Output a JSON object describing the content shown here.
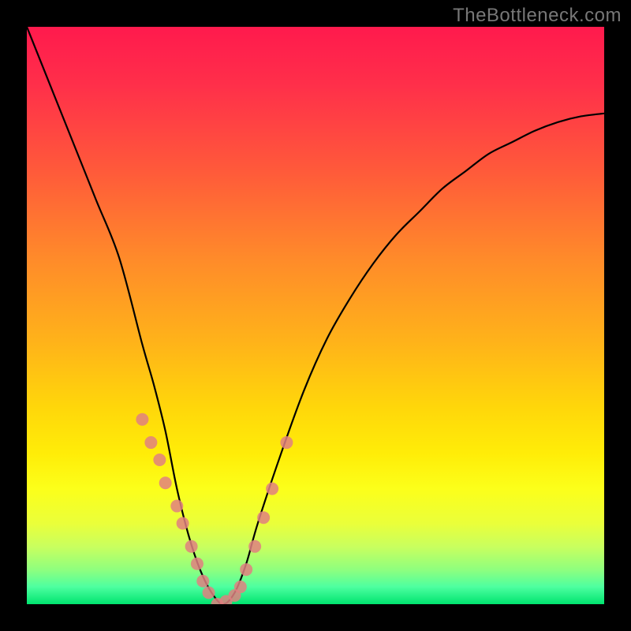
{
  "watermark": "TheBottleneck.com",
  "chart_data": {
    "type": "line",
    "title": "",
    "xlabel": "",
    "ylabel": "",
    "xlim": [
      0,
      100
    ],
    "ylim": [
      0,
      100
    ],
    "grid": false,
    "series": [
      {
        "name": "curve",
        "x": [
          0,
          4,
          8,
          12,
          16,
          20,
          22,
          24,
          26,
          28,
          30,
          32,
          34,
          36,
          38,
          40,
          44,
          48,
          52,
          56,
          60,
          64,
          68,
          72,
          76,
          80,
          84,
          88,
          92,
          96,
          100
        ],
        "values": [
          100,
          90,
          80,
          70,
          60,
          45,
          38,
          30,
          20,
          12,
          6,
          2,
          0,
          2,
          7,
          14,
          26,
          37,
          46,
          53,
          59,
          64,
          68,
          72,
          75,
          78,
          80,
          82,
          83.5,
          84.5,
          85
        ]
      }
    ],
    "markers": {
      "name": "scatter-points",
      "color": "#e08080",
      "x": [
        20,
        21.5,
        23,
        24,
        26,
        27,
        28.5,
        29.5,
        30.5,
        31.5,
        33,
        34.5,
        36,
        37,
        38,
        39.5,
        41,
        42.5,
        45
      ],
      "values": [
        32,
        28,
        25,
        21,
        17,
        14,
        10,
        7,
        4,
        2,
        0,
        0.5,
        1.5,
        3,
        6,
        10,
        15,
        20,
        28
      ]
    }
  }
}
